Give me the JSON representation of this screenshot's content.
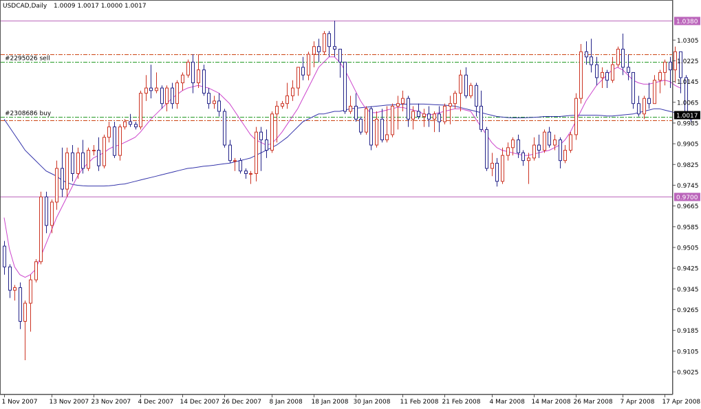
{
  "chart_data": {
    "type": "candlestick",
    "symbol_label": "USDCAD,Daily",
    "ohlc_label": "1.0009 1.0017 1.0000 1.0017",
    "ylim": [
      0.9025,
      1.0415
    ],
    "y_ticks": [
      "1.0305",
      "1.0225",
      "1.0145",
      "1.0065",
      "0.9985",
      "0.9905",
      "0.9825",
      "0.9745",
      "0.9665",
      "0.9585",
      "0.9505",
      "0.9425",
      "0.9345",
      "0.9265",
      "0.9185",
      "0.9105",
      "0.9025"
    ],
    "x_labels": [
      {
        "bar": 0,
        "label": "1 Nov 2007"
      },
      {
        "bar": 9,
        "label": "13 Nov 2007"
      },
      {
        "bar": 17,
        "label": "23 Nov 2007"
      },
      {
        "bar": 26,
        "label": "4 Dec 2007"
      },
      {
        "bar": 34,
        "label": "14 Dec 2007"
      },
      {
        "bar": 42,
        "label": "26 Dec 2007"
      },
      {
        "bar": 51,
        "label": "8 Jan 2008"
      },
      {
        "bar": 59,
        "label": "18 Jan 2008"
      },
      {
        "bar": 67,
        "label": "30 Jan 2008"
      },
      {
        "bar": 76,
        "label": "11 Feb 2008"
      },
      {
        "bar": 84,
        "label": "21 Feb 2008"
      },
      {
        "bar": 93,
        "label": "4 Mar 2008"
      },
      {
        "bar": 101,
        "label": "14 Mar 2008"
      },
      {
        "bar": 109,
        "label": "26 Mar 2008"
      },
      {
        "bar": 118,
        "label": "7 Apr 2008"
      },
      {
        "bar": 126,
        "label": "17 Apr 2008"
      }
    ],
    "candles": [
      [
        0.951,
        0.953,
        0.94,
        0.943
      ],
      [
        0.943,
        0.944,
        0.931,
        0.934
      ],
      [
        0.934,
        0.936,
        0.93,
        0.935
      ],
      [
        0.935,
        0.937,
        0.919,
        0.922
      ],
      [
        0.922,
        0.93,
        0.907,
        0.929
      ],
      [
        0.929,
        0.94,
        0.918,
        0.938
      ],
      [
        0.938,
        0.946,
        0.937,
        0.945
      ],
      [
        0.945,
        0.972,
        0.944,
        0.97
      ],
      [
        0.97,
        0.972,
        0.956,
        0.959
      ],
      [
        0.959,
        0.969,
        0.956,
        0.968
      ],
      [
        0.968,
        0.984,
        0.965,
        0.981
      ],
      [
        0.981,
        0.989,
        0.97,
        0.973
      ],
      [
        0.973,
        0.989,
        0.97,
        0.987
      ],
      [
        0.987,
        0.99,
        0.976,
        0.979
      ],
      [
        0.979,
        0.989,
        0.977,
        0.987
      ],
      [
        0.987,
        0.992,
        0.979,
        0.981
      ],
      [
        0.981,
        0.989,
        0.98,
        0.988
      ],
      [
        0.988,
        0.99,
        0.986,
        0.988
      ],
      [
        0.988,
        0.993,
        0.98,
        0.982
      ],
      [
        0.982,
        0.994,
        0.981,
        0.993
      ],
      [
        0.993,
        0.999,
        0.991,
        0.997
      ],
      [
        0.997,
        0.999,
        0.985,
        0.986
      ],
      [
        0.986,
        0.998,
        0.984,
        0.997
      ],
      [
        0.997,
        1.0,
        0.996,
        0.999
      ],
      [
        0.999,
        1.002,
        0.997,
        0.998
      ],
      [
        0.998,
        0.999,
        0.996,
        0.997
      ],
      [
        0.997,
        1.011,
        0.996,
        1.01
      ],
      [
        1.01,
        1.017,
        1.007,
        1.012
      ],
      [
        1.012,
        1.021,
        1.008,
        1.011
      ],
      [
        1.011,
        1.018,
        1.01,
        1.012
      ],
      [
        1.012,
        1.013,
        1.004,
        1.006
      ],
      [
        1.006,
        1.013,
        1.003,
        1.012
      ],
      [
        1.012,
        1.014,
        1.004,
        1.006
      ],
      [
        1.006,
        1.015,
        1.004,
        1.014
      ],
      [
        1.014,
        1.018,
        1.011,
        1.017
      ],
      [
        1.017,
        1.023,
        1.016,
        1.022
      ],
      [
        1.022,
        1.025,
        1.01,
        1.014
      ],
      [
        1.014,
        1.025,
        1.012,
        1.019
      ],
      [
        1.019,
        1.021,
        1.009,
        1.01
      ],
      [
        1.01,
        1.012,
        1.004,
        1.006
      ],
      [
        1.006,
        1.009,
        1.004,
        1.007
      ],
      [
        1.007,
        1.01,
        1.001,
        1.003
      ],
      [
        1.003,
        1.004,
        0.989,
        0.99
      ],
      [
        0.99,
        0.992,
        0.983,
        0.984
      ],
      [
        0.984,
        0.985,
        0.98,
        0.984
      ],
      [
        0.984,
        0.985,
        0.979,
        0.98
      ],
      [
        0.98,
        0.981,
        0.977,
        0.979
      ],
      [
        0.979,
        0.98,
        0.975,
        0.979
      ],
      [
        0.979,
        0.997,
        0.976,
        0.995
      ],
      [
        0.995,
        0.997,
        0.98,
        0.992
      ],
      [
        0.992,
        0.996,
        0.985,
        0.988
      ],
      [
        0.988,
        1.003,
        0.987,
        1.002
      ],
      [
        1.002,
        1.007,
        0.991,
        1.005
      ],
      [
        1.005,
        1.007,
        1.004,
        1.006
      ],
      [
        1.006,
        1.014,
        1.004,
        1.009
      ],
      [
        1.009,
        1.015,
        1.007,
        1.012
      ],
      [
        1.012,
        1.02,
        1.009,
        1.02
      ],
      [
        1.02,
        1.024,
        1.015,
        1.017
      ],
      [
        1.017,
        1.026,
        1.015,
        1.025
      ],
      [
        1.025,
        1.03,
        1.02,
        1.028
      ],
      [
        1.028,
        1.031,
        1.022,
        1.026
      ],
      [
        1.026,
        1.034,
        1.025,
        1.033
      ],
      [
        1.033,
        1.034,
        1.024,
        1.028
      ],
      [
        1.028,
        1.038,
        1.024,
        1.027
      ],
      [
        1.027,
        1.027,
        1.016,
        1.022
      ],
      [
        1.022,
        1.022,
        1.002,
        1.003
      ],
      [
        1.003,
        1.009,
        1.002,
        1.005
      ],
      [
        1.005,
        1.01,
        0.999,
        1.0
      ],
      [
        1.0,
        1.001,
        0.994,
        0.995
      ],
      [
        0.995,
        1.005,
        0.994,
        1.004
      ],
      [
        1.004,
        1.005,
        0.988,
        0.99
      ],
      [
        0.99,
        1.003,
        0.989,
        1.0
      ],
      [
        1.0,
        1.004,
        0.991,
        0.992
      ],
      [
        0.992,
        1.005,
        0.991,
        0.994
      ],
      [
        0.994,
        1.006,
        0.993,
        1.005
      ],
      [
        1.005,
        1.009,
        0.996,
        1.006
      ],
      [
        1.006,
        1.011,
        1.003,
        1.008
      ],
      [
        1.008,
        1.009,
        0.997,
        1.0
      ],
      [
        1.0,
        1.005,
        0.996,
        1.003
      ],
      [
        1.003,
        1.006,
        1.0,
        1.001
      ],
      [
        1.001,
        1.004,
        0.997,
        1.002
      ],
      [
        1.002,
        1.005,
        0.997,
        1.0
      ],
      [
        1.0,
        1.003,
        0.995,
        1.002
      ],
      [
        1.002,
        1.005,
        0.995,
        0.999
      ],
      [
        0.999,
        1.006,
        0.998,
        1.005
      ],
      [
        1.005,
        1.009,
        0.998,
        1.006
      ],
      [
        1.006,
        1.011,
        1.004,
        1.01
      ],
      [
        1.01,
        1.019,
        1.003,
        1.017
      ],
      [
        1.017,
        1.02,
        1.008,
        1.009
      ],
      [
        1.009,
        1.014,
        1.008,
        1.013
      ],
      [
        1.013,
        1.014,
        1.001,
        1.005
      ],
      [
        1.005,
        1.011,
        0.995,
        0.996
      ],
      [
        0.996,
        0.997,
        0.98,
        0.981
      ],
      [
        0.981,
        0.987,
        0.978,
        0.983
      ],
      [
        0.983,
        0.985,
        0.974,
        0.976
      ],
      [
        0.976,
        0.989,
        0.975,
        0.986
      ],
      [
        0.986,
        0.991,
        0.984,
        0.989
      ],
      [
        0.989,
        0.993,
        0.986,
        0.992
      ],
      [
        0.992,
        0.994,
        0.985,
        0.987
      ],
      [
        0.987,
        0.988,
        0.982,
        0.984
      ],
      [
        0.984,
        0.987,
        0.975,
        0.985
      ],
      [
        0.985,
        0.993,
        0.984,
        0.99
      ],
      [
        0.99,
        0.994,
        0.985,
        0.988
      ],
      [
        0.988,
        0.996,
        0.987,
        0.995
      ],
      [
        0.995,
        0.997,
        0.989,
        0.99
      ],
      [
        0.99,
        0.994,
        0.988,
        0.992
      ],
      [
        0.992,
        0.993,
        0.981,
        0.984
      ],
      [
        0.984,
        0.99,
        0.983,
        0.988
      ],
      [
        0.988,
        0.995,
        0.987,
        0.994
      ],
      [
        0.994,
        1.01,
        0.992,
        1.008
      ],
      [
        1.008,
        1.029,
        1.006,
        1.026
      ],
      [
        1.026,
        1.03,
        1.021,
        1.024
      ],
      [
        1.024,
        1.031,
        1.018,
        1.021
      ],
      [
        1.021,
        1.024,
        1.013,
        1.016
      ],
      [
        1.016,
        1.02,
        1.012,
        1.018
      ],
      [
        1.018,
        1.019,
        1.012,
        1.015
      ],
      [
        1.015,
        1.024,
        1.014,
        1.021
      ],
      [
        1.021,
        1.028,
        1.02,
        1.027
      ],
      [
        1.027,
        1.033,
        1.017,
        1.02
      ],
      [
        1.02,
        1.025,
        1.015,
        1.018
      ],
      [
        1.018,
        1.018,
        1.004,
        1.006
      ],
      [
        1.006,
        1.009,
        1.001,
        1.002
      ],
      [
        1.002,
        1.009,
        1.0,
        1.008
      ],
      [
        1.008,
        1.014,
        1.004,
        1.006
      ],
      [
        1.006,
        1.017,
        1.006,
        1.015
      ],
      [
        1.015,
        1.019,
        1.01,
        1.018
      ],
      [
        1.018,
        1.023,
        1.013,
        1.022
      ],
      [
        1.022,
        1.024,
        1.012,
        1.019
      ],
      [
        1.019,
        1.028,
        1.014,
        1.026
      ],
      [
        1.026,
        1.026,
        1.01,
        1.016
      ],
      [
        1.016,
        1.017,
        1.0,
        1.001
      ],
      [
        1.001,
        1.002,
        0.999,
        1.0
      ]
    ],
    "ma_fast_color": "#cc44cc",
    "ma_slow_color": "#3333aa",
    "ma_fast": [
      0.962,
      0.95,
      0.943,
      0.94,
      0.939,
      0.94,
      0.942,
      0.947,
      0.952,
      0.957,
      0.962,
      0.966,
      0.97,
      0.974,
      0.978,
      0.981,
      0.983,
      0.985,
      0.986,
      0.987,
      0.9885,
      0.9895,
      0.99,
      0.991,
      0.992,
      0.993,
      0.995,
      0.9975,
      1.0,
      1.002,
      1.004,
      1.006,
      1.008,
      1.0095,
      1.011,
      1.012,
      1.0125,
      1.013,
      1.0125,
      1.012,
      1.011,
      1.01,
      1.008,
      1.006,
      1.003,
      1.0,
      0.997,
      0.994,
      0.992,
      0.991,
      0.99,
      0.9905,
      0.9925,
      0.995,
      0.998,
      1.001,
      1.004,
      1.008,
      1.012,
      1.016,
      1.02,
      1.022,
      1.024,
      1.024,
      1.022,
      1.019,
      1.015,
      1.011,
      1.007,
      1.004,
      1.0025,
      1.0025,
      1.003,
      1.0035,
      1.004,
      1.0045,
      1.0045,
      1.004,
      1.0035,
      1.003,
      1.002,
      1.0015,
      1.002,
      1.0025,
      1.003,
      1.0035,
      1.004,
      1.004,
      1.0035,
      1.003,
      1.0,
      0.997,
      0.994,
      0.991,
      0.989,
      0.988,
      0.9875,
      0.987,
      0.9865,
      0.986,
      0.986,
      0.9865,
      0.987,
      0.9875,
      0.988,
      0.989,
      0.99,
      0.992,
      0.995,
      0.999,
      1.003,
      1.007,
      1.01,
      1.013,
      1.015,
      1.017,
      1.019,
      1.02,
      1.019,
      1.017,
      1.015,
      1.014,
      1.0135,
      1.0135,
      1.014,
      1.0145,
      1.015,
      1.0145,
      1.013,
      1.012
    ],
    "ma_slow": [
      1.0,
      0.997,
      0.994,
      0.991,
      0.988,
      0.986,
      0.984,
      0.982,
      0.98,
      0.979,
      0.978,
      0.9765,
      0.9755,
      0.9748,
      0.9745,
      0.9743,
      0.9742,
      0.9742,
      0.9742,
      0.9742,
      0.9743,
      0.9745,
      0.9748,
      0.975,
      0.9755,
      0.976,
      0.9765,
      0.977,
      0.9775,
      0.978,
      0.9785,
      0.979,
      0.9795,
      0.98,
      0.9805,
      0.981,
      0.9812,
      0.9815,
      0.9818,
      0.982,
      0.9822,
      0.9825,
      0.9828,
      0.983,
      0.9835,
      0.984,
      0.9845,
      0.985,
      0.986,
      0.987,
      0.988,
      0.989,
      0.99,
      0.9915,
      0.993,
      0.995,
      0.997,
      0.999,
      1.0,
      1.001,
      1.002,
      1.002,
      1.0025,
      1.003,
      1.003,
      1.0035,
      1.004,
      1.0042,
      1.0044,
      1.0046,
      1.0048,
      1.005,
      1.0052,
      1.0054,
      1.0055,
      1.0056,
      1.0057,
      1.0058,
      1.0058,
      1.0058,
      1.0058,
      1.0057,
      1.0056,
      1.0055,
      1.0054,
      1.0052,
      1.005,
      1.0045,
      1.004,
      1.0035,
      1.003,
      1.0025,
      1.002,
      1.0015,
      1.001,
      1.0008,
      1.0006,
      1.0005,
      1.0005,
      1.0005,
      1.0006,
      1.0007,
      1.0008,
      1.001,
      1.001,
      1.001,
      1.001,
      1.0012,
      1.0014,
      1.0015,
      1.0015,
      1.0015,
      1.0015,
      1.0015,
      1.0014,
      1.0012,
      1.0012,
      1.0014,
      1.0016,
      1.0018,
      1.002,
      1.0025,
      1.003,
      1.0035,
      1.004,
      1.004,
      1.0035,
      1.003,
      1.0025
    ],
    "horizontal_lines": [
      {
        "name": "upper-level-line",
        "price": 1.038,
        "color": "#bb66bb",
        "style": "solid",
        "label": "1.0380"
      },
      {
        "name": "lower-level-line",
        "price": 0.97,
        "color": "#bb66bb",
        "style": "solid",
        "label": "0.9700"
      },
      {
        "name": "sell-stop-line",
        "price": 1.025,
        "color": "#cc4411",
        "style": "dashdot",
        "label": ""
      },
      {
        "name": "sell-order-line",
        "price": 1.022,
        "color": "#229922",
        "style": "dashdot",
        "label": "#2295026 sell"
      },
      {
        "name": "buy-order-line",
        "price": 1.001,
        "color": "#229922",
        "style": "dashdot",
        "label": "#2308686 buy"
      },
      {
        "name": "buy-stop-line",
        "price": 0.9995,
        "color": "#cc4411",
        "style": "dashdot",
        "label": ""
      }
    ],
    "current_price": {
      "price": 1.0017,
      "label": "1.0017"
    },
    "bull_color": "#cc3322",
    "bear_color": "#222288",
    "grid": false
  }
}
